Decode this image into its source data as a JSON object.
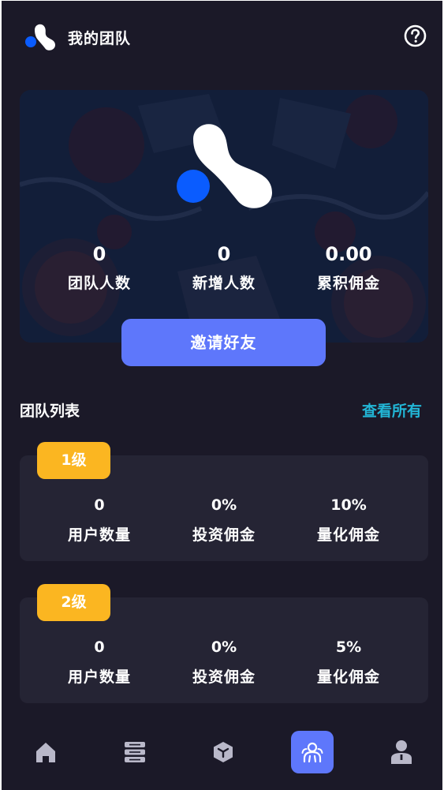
{
  "header": {
    "title": "我的团队",
    "logo_icon": "brand-logo-icon",
    "help_icon": "help-circle-icon"
  },
  "banner": {
    "stats": [
      {
        "value": "0",
        "label": "团队人数"
      },
      {
        "value": "0",
        "label": "新增人数"
      },
      {
        "value": "0.00",
        "label": "累积佣金"
      }
    ],
    "invite_label": "邀请好友"
  },
  "team_list": {
    "title": "团队列表",
    "view_all": "查看所有",
    "levels": [
      {
        "badge": "1级",
        "stats": [
          {
            "value": "0",
            "label": "用户数量"
          },
          {
            "value": "0%",
            "label": "投资佣金"
          },
          {
            "value": "10%",
            "label": "量化佣金"
          }
        ]
      },
      {
        "badge": "2级",
        "stats": [
          {
            "value": "0",
            "label": "用户数量"
          },
          {
            "value": "0%",
            "label": "投资佣金"
          },
          {
            "value": "5%",
            "label": "量化佣金"
          }
        ]
      }
    ]
  },
  "nav": {
    "items": [
      {
        "icon": "home-icon",
        "active": false
      },
      {
        "icon": "server-icon",
        "active": false
      },
      {
        "icon": "cube-icon",
        "active": false
      },
      {
        "icon": "team-icon",
        "active": true
      },
      {
        "icon": "user-icon",
        "active": false
      }
    ]
  },
  "colors": {
    "background": "#1b1928",
    "accent": "#5e77fb",
    "badge": "#fbb621",
    "link": "#22b6d6",
    "card": "#252434",
    "logo_dot": "#0a5cff"
  }
}
